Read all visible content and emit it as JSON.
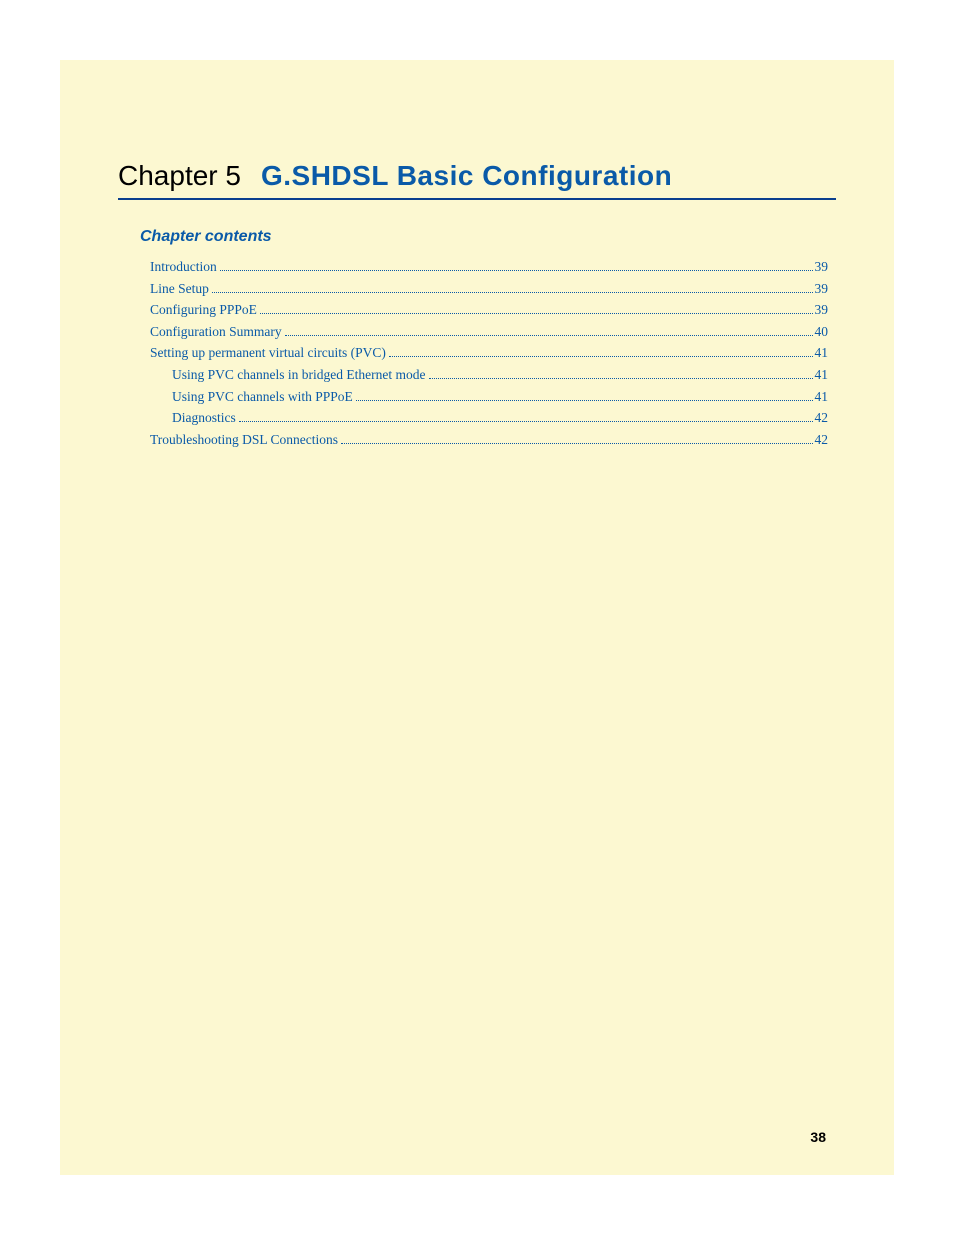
{
  "chapter": {
    "label": "Chapter 5",
    "title": "G.SHDSL Basic Configuration"
  },
  "contents_heading": "Chapter contents",
  "toc": [
    {
      "label": "Introduction",
      "page": "39",
      "sub": false
    },
    {
      "label": "Line Setup",
      "page": "39",
      "sub": false
    },
    {
      "label": "Configuring PPPoE",
      "page": "39",
      "sub": false
    },
    {
      "label": "Configuration Summary",
      "page": "40",
      "sub": false
    },
    {
      "label": "Setting up permanent virtual circuits (PVC)",
      "page": "41",
      "sub": false
    },
    {
      "label": "Using PVC channels in bridged Ethernet mode",
      "page": "41",
      "sub": true
    },
    {
      "label": "Using PVC channels with PPPoE",
      "page": "41",
      "sub": true
    },
    {
      "label": "Diagnostics",
      "page": "42",
      "sub": true
    },
    {
      "label": "Troubleshooting DSL Connections",
      "page": "42",
      "sub": false
    }
  ],
  "page_number": "38"
}
